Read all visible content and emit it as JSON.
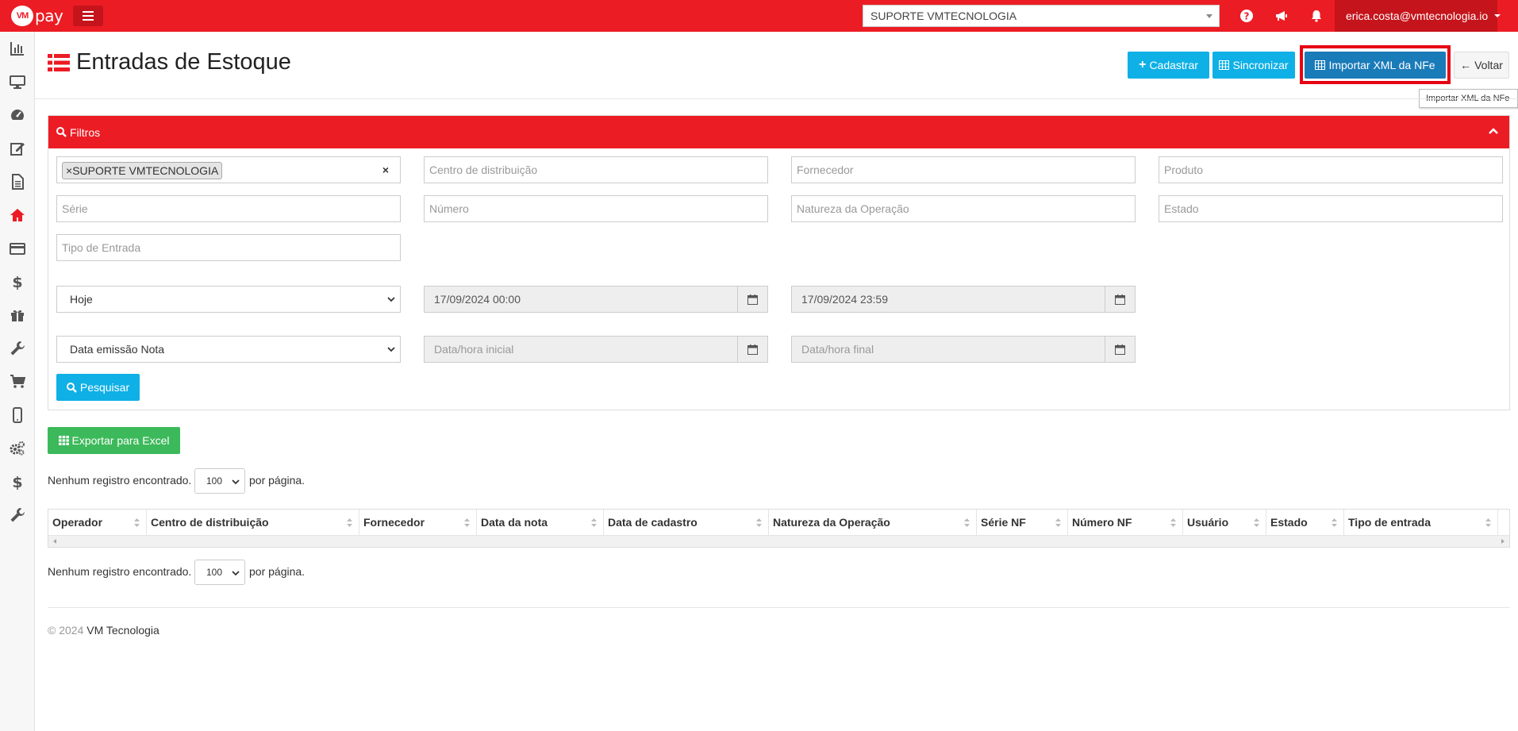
{
  "app": {
    "logo_mark": "VM",
    "logo_text": "pay"
  },
  "topbar": {
    "company_select": "SUPORTE VMTECNOLOGIA",
    "user": "erica.costa@vmtecnologia.io",
    "icons": [
      "question-icon",
      "bullhorn-icon",
      "bell-icon"
    ]
  },
  "sidebar": {
    "items": [
      "bar-chart-icon",
      "desktop-icon",
      "dashboard-icon",
      "edit-icon",
      "document-icon",
      "home-icon",
      "credit-card-icon",
      "dollar-icon",
      "gift-icon",
      "wrench-icon",
      "cart-icon",
      "mobile-icon",
      "cogs-icon",
      "dollar-icon",
      "wrench-icon"
    ],
    "active_index": 5
  },
  "page": {
    "title": "Entradas de Estoque",
    "buttons": {
      "cadastrar": "Cadastrar",
      "sincronizar": "Sincronizar",
      "importar": "Importar XML da NFe",
      "voltar": "Voltar"
    },
    "tooltip": "Importar XML da NFe"
  },
  "filters": {
    "heading": "Filtros",
    "company_tag": "SUPORTE VMTECNOLOGIA",
    "clear": "×",
    "tag_remove": "×",
    "placeholders": {
      "centro": "Centro de distribuição",
      "fornecedor": "Fornecedor",
      "produto": "Produto",
      "serie": "Série",
      "numero": "Número",
      "natureza": "Natureza da Operação",
      "estado": "Estado",
      "tipo_entrada": "Tipo de Entrada",
      "data_inicial": "Data/hora inicial",
      "data_final": "Data/hora final"
    },
    "period_select": "Hoje",
    "date_from": "17/09/2024 00:00",
    "date_to": "17/09/2024 23:59",
    "date_type_select": "Data emissão Nota",
    "search_button": "Pesquisar"
  },
  "results": {
    "export_button": "Exportar para Excel",
    "no_records": "Nenhum registro encontrado.",
    "page_size": "100",
    "per_page": "por página.",
    "columns": [
      "Operador",
      "Centro de distribuição",
      "Fornecedor",
      "Data da nota",
      "Data de cadastro",
      "Natureza da Operação",
      "Série NF",
      "Número NF",
      "Usuário",
      "Estado",
      "Tipo de entrada"
    ]
  },
  "footer": {
    "copyright": "© 2024",
    "company": "VM Tecnologia"
  },
  "colors": {
    "brand_red": "#ec1c24",
    "info": "#0fb0e6",
    "primary": "#1a7bb9",
    "success": "#3cb95a"
  }
}
